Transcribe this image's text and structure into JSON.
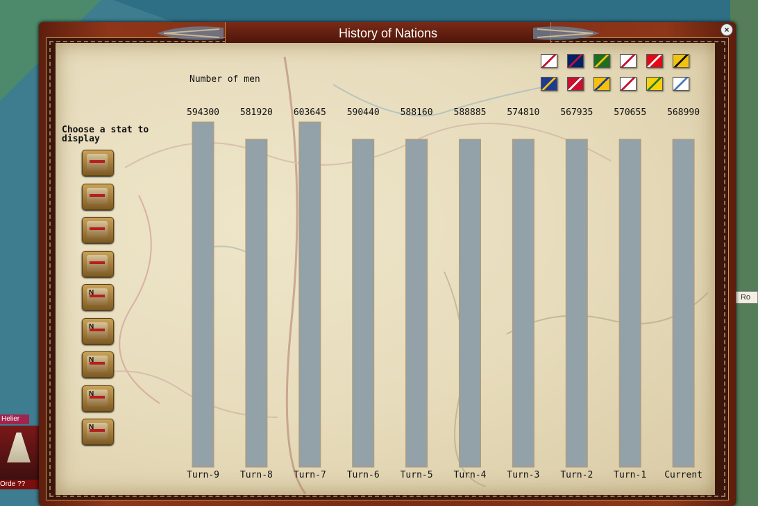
{
  "window": {
    "title": "History of Nations",
    "close_label": "×"
  },
  "background": {
    "side_name": "Helier",
    "side_order": "Orde ??",
    "right_badge": "Ro"
  },
  "stat_panel": {
    "choose_label": "Choose a stat to display",
    "buttons": [
      {
        "name": "stat-button-1",
        "icon": "building-icon",
        "letter": ""
      },
      {
        "name": "stat-button-2",
        "icon": "cannon-icon",
        "letter": ""
      },
      {
        "name": "stat-button-3",
        "icon": "ship-icon",
        "letter": ""
      },
      {
        "name": "stat-button-4",
        "icon": "soldiers-icon",
        "letter": ""
      },
      {
        "name": "stat-button-5",
        "icon": "infantry-icon",
        "letter": "N"
      },
      {
        "name": "stat-button-6",
        "icon": "cavalry-icon",
        "letter": "N"
      },
      {
        "name": "stat-button-7",
        "icon": "artillery-icon",
        "letter": "N"
      },
      {
        "name": "stat-button-8",
        "icon": "casualties-icon",
        "letter": "N"
      },
      {
        "name": "stat-button-9",
        "icon": "flag-stat-icon",
        "letter": "N"
      }
    ]
  },
  "flags": [
    {
      "name": "flag-1",
      "colors": [
        "#ffffff",
        "#c8102e"
      ]
    },
    {
      "name": "flag-2",
      "colors": [
        "#012169",
        "#c8102e"
      ]
    },
    {
      "name": "flag-3",
      "colors": [
        "#1e6e1e",
        "#f4c20d"
      ]
    },
    {
      "name": "flag-4",
      "colors": [
        "#ffffff",
        "#c8102e"
      ]
    },
    {
      "name": "flag-5",
      "colors": [
        "#e30a17",
        "#ffffff"
      ]
    },
    {
      "name": "flag-6",
      "colors": [
        "#f4c20d",
        "#111111"
      ]
    },
    {
      "name": "flag-7",
      "colors": [
        "#1f3a93",
        "#f4c20d"
      ]
    },
    {
      "name": "flag-8",
      "colors": [
        "#c8102e",
        "#ffffff"
      ]
    },
    {
      "name": "flag-9",
      "colors": [
        "#f4c20d",
        "#1f3a93"
      ]
    },
    {
      "name": "flag-10",
      "colors": [
        "#ffffff",
        "#c8102e"
      ]
    },
    {
      "name": "flag-11",
      "colors": [
        "#f4d20d",
        "#2a7a2a"
      ]
    },
    {
      "name": "flag-12",
      "colors": [
        "#ffffff",
        "#4a7ab5"
      ]
    }
  ],
  "chart_data": {
    "type": "bar",
    "title": "Number of men",
    "categories": [
      "Turn-9",
      "Turn-8",
      "Turn-7",
      "Turn-6",
      "Turn-5",
      "Turn-4",
      "Turn-3",
      "Turn-2",
      "Turn-1",
      "Current"
    ],
    "values": [
      594300,
      581920,
      603645,
      590440,
      588160,
      588885,
      574810,
      567935,
      570655,
      568990
    ],
    "bar_heights_relative": [
      1.0,
      0.95,
      1.0,
      0.95,
      0.95,
      0.95,
      0.95,
      0.95,
      0.95,
      0.95
    ],
    "bar_color": "#93a1a8",
    "grid": false
  }
}
